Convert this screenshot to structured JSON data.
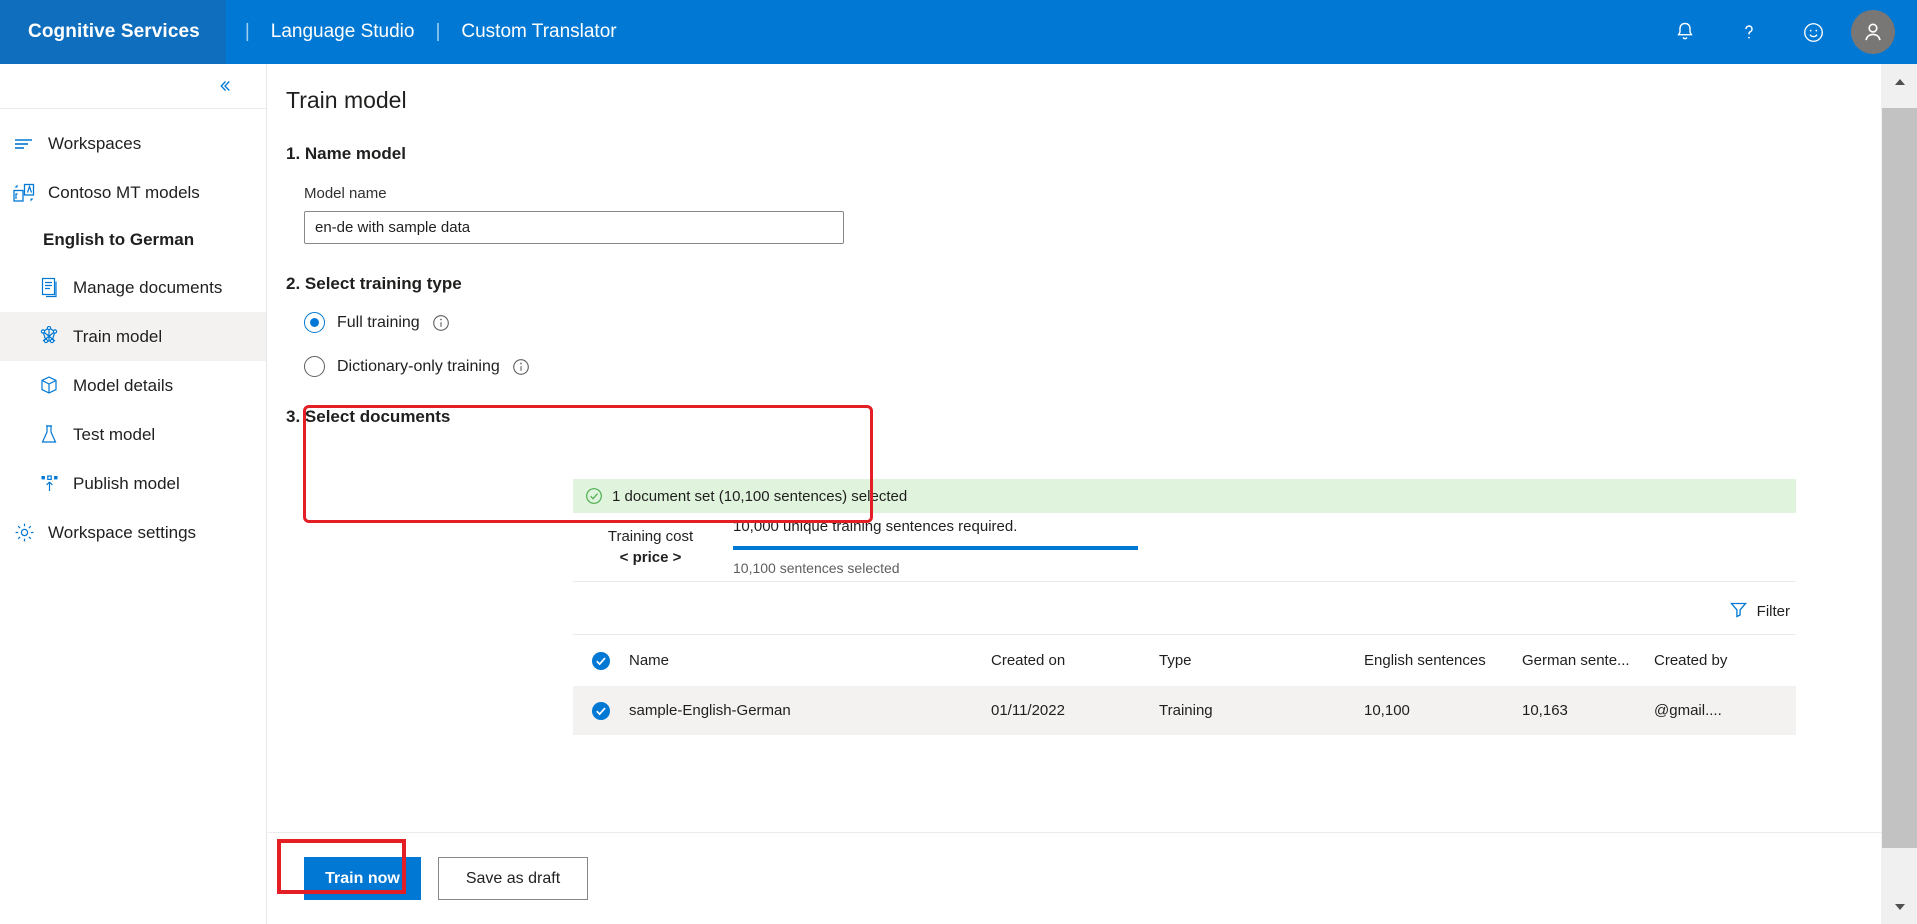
{
  "topbar": {
    "brand": "Cognitive Services",
    "separator": "|",
    "links": [
      "Language Studio",
      "Custom Translator"
    ],
    "icons": [
      "bell-icon",
      "help-icon",
      "feedback-smiley-icon",
      "account-avatar"
    ],
    "background_color": "#0078d4",
    "brand_background_color": "#106ebe"
  },
  "sidebar": {
    "collapse_icon": "double-chevron-left-icon",
    "items": [
      {
        "label": "Workspaces",
        "icon": "workspaces-icon",
        "level": "top",
        "selected": false
      },
      {
        "label": "Contoso MT models",
        "icon": "translate-models-icon",
        "level": "top",
        "selected": false
      },
      {
        "label": "English to German",
        "icon": "",
        "level": "group-title",
        "selected": false
      },
      {
        "label": "Manage documents",
        "icon": "document-icon",
        "level": "sub",
        "selected": false
      },
      {
        "label": "Train model",
        "icon": "train-model-icon",
        "level": "sub",
        "selected": true
      },
      {
        "label": "Model details",
        "icon": "package-icon",
        "level": "sub",
        "selected": false
      },
      {
        "label": "Test model",
        "icon": "flask-icon",
        "level": "sub",
        "selected": false
      },
      {
        "label": "Publish model",
        "icon": "publish-upload-icon",
        "level": "sub",
        "selected": false
      },
      {
        "label": "Workspace settings",
        "icon": "gear-icon",
        "level": "top",
        "selected": false
      }
    ]
  },
  "main": {
    "page_title": "Train model",
    "step1": {
      "heading": "1. Name model",
      "field_label": "Model name",
      "model_name_value": "en-de with sample data",
      "model_name_placeholder": "Model name"
    },
    "step2": {
      "heading": "2. Select training type",
      "options": [
        {
          "label": "Full training",
          "selected": true,
          "info_icon": "info-icon"
        },
        {
          "label": "Dictionary-only training",
          "selected": false,
          "info_icon": "info-icon"
        }
      ]
    },
    "step3": {
      "heading": "3. Select documents",
      "banner": {
        "icon": "check-circle-icon",
        "text": "1 document set (10,100 sentences) selected",
        "background_color": "#dff3dd",
        "icon_color": "#107c10"
      },
      "cost": {
        "label": "Training cost",
        "price": "< price >",
        "requirement_text": "10,000 unique training sentences required.",
        "selected_text": "10,100 sentences selected",
        "progress_percent": 100,
        "progress_color": "#0078d4"
      },
      "filter": {
        "label": "Filter",
        "icon": "filter-icon"
      },
      "table": {
        "columns": [
          "Name",
          "Created on",
          "Type",
          "English sentences",
          "German sente...",
          "Created by"
        ],
        "header_checkbox_checked": true,
        "rows": [
          {
            "checked": true,
            "name": "sample-English-German",
            "created_on": "01/11/2022",
            "type": "Training",
            "english_sentences": "10,100",
            "german_sentences": "10,163",
            "created_by": "@gmail...."
          }
        ]
      }
    },
    "footer": {
      "primary_button": "Train now",
      "secondary_button": "Save as draft"
    }
  },
  "annotations": {
    "highlight_color": "#e31e24",
    "boxes": [
      "document-set-summary-highlight",
      "train-now-button-highlight"
    ]
  },
  "scrollbar": {
    "up_icon": "chevron-up-icon",
    "down_icon": "chevron-down-icon"
  }
}
